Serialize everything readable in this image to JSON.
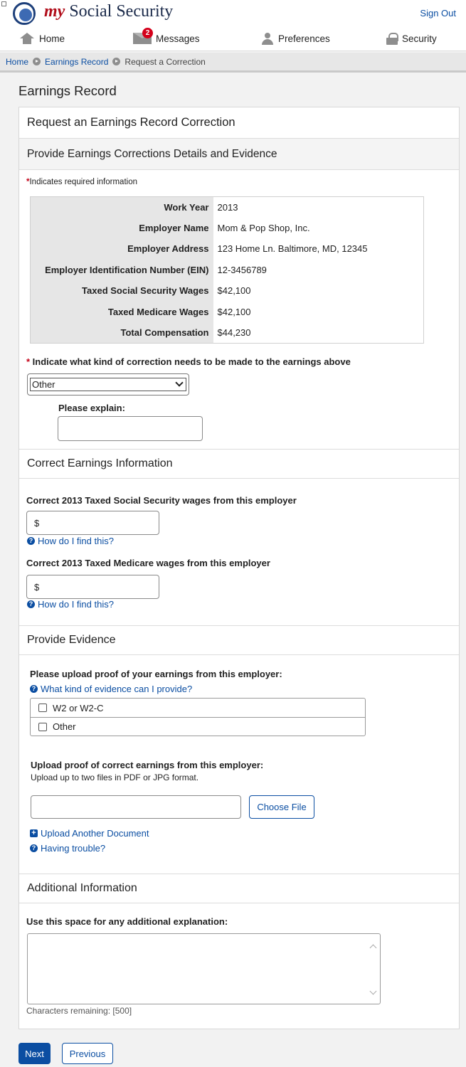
{
  "header": {
    "brand_my": "my",
    "brand_rest": "Social Security",
    "signout_label": "Sign Out"
  },
  "nav": {
    "home_label": "Home",
    "messages_label": "Messages",
    "messages_count": "2",
    "preferences_label": "Preferences",
    "security_label": "Security"
  },
  "breadcrumb": {
    "home": "Home",
    "earnings": "Earnings Record",
    "current": "Request a Correction"
  },
  "page": {
    "title": "Earnings Record",
    "panel_title": "Request an Earnings Record Correction",
    "section_title": "Provide Earnings Corrections Details and Evidence",
    "required_note": "Indicates required information"
  },
  "record": [
    {
      "key": "Work Year",
      "value": "2013"
    },
    {
      "key": "Employer Name",
      "value": "Mom & Pop Shop, Inc."
    },
    {
      "key": "Employer Address",
      "value": "123 Home Ln. Baltimore, MD, 12345"
    },
    {
      "key": "Employer Identification Number (EIN)",
      "value": "12-3456789"
    },
    {
      "key": "Taxed Social Security Wages",
      "value": "$42,100"
    },
    {
      "key": "Taxed Medicare Wages",
      "value": "$42,100"
    },
    {
      "key": "Total Compensation",
      "value": "$44,230"
    }
  ],
  "correction": {
    "question": "Indicate what kind of correction needs to be made to the earnings above",
    "selected": "Other",
    "explain_label": "Please explain:",
    "explain_value": ""
  },
  "correct_earnings": {
    "title": "Correct Earnings Information",
    "ss_label": "Correct 2013 Taxed Social Security wages from this employer",
    "ss_prefix": "$",
    "medicare_label": "Correct 2013 Taxed Medicare wages from this employer",
    "medicare_prefix": "$",
    "help_label": "How do I find this?"
  },
  "evidence": {
    "title": "Provide Evidence",
    "prompt": "Please upload proof of your earnings from this employer:",
    "help_label": "What kind of evidence can I provide?",
    "option_w2": "W2 or W2-C",
    "option_other": "Other",
    "upload_label": "Upload proof of correct earnings from this employer:",
    "upload_hint": "Upload up to two files in PDF or JPG format.",
    "choose_file": "Choose File",
    "upload_another": "Upload Another Document",
    "trouble": "Having trouble?"
  },
  "additional": {
    "title": "Additional Information",
    "prompt": "Use this space for any additional explanation:",
    "value": "",
    "remaining": "Characters remaining: [500]"
  },
  "actions": {
    "next": "Next",
    "previous": "Previous"
  }
}
